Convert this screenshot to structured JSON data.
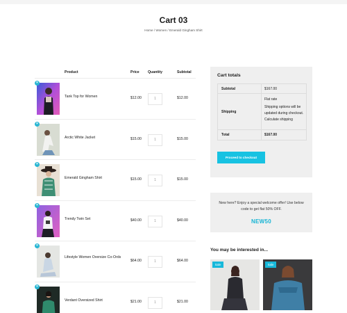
{
  "page": {
    "title": "Cart 03",
    "breadcrumb": "Home / Women / Emerald Gingham Shirt"
  },
  "cart": {
    "headers": {
      "product": "Product",
      "price": "Price",
      "quantity": "Quantity",
      "subtotal": "Subtotal"
    },
    "remove_symbol": "×",
    "items": [
      {
        "name": "Tank Top for Women",
        "price": "$12.00",
        "qty": "1",
        "subtotal": "$12.00"
      },
      {
        "name": "Arctic White Jacket",
        "price": "$15.00",
        "qty": "1",
        "subtotal": "$15.00"
      },
      {
        "name": "Emerald Gingham Shirt",
        "price": "$15.00",
        "qty": "1",
        "subtotal": "$15.00"
      },
      {
        "name": "Trendy Twin Set",
        "price": "$40.00",
        "qty": "1",
        "subtotal": "$40.00"
      },
      {
        "name": "Lifestyle Women Oversize Co-Ords",
        "price": "$64.00",
        "qty": "1",
        "subtotal": "$64.00"
      },
      {
        "name": "Verdant Oversized Shirt",
        "price": "$21.00",
        "qty": "1",
        "subtotal": "$21.00"
      }
    ]
  },
  "totals": {
    "title": "Cart totals",
    "subtotal_label": "Subtotal",
    "subtotal_value": "$167.00",
    "shipping_label": "Shipping",
    "shipping_method": "Flat rate",
    "shipping_note": "Shipping options will be updated during checkout. Calculate shipping",
    "total_label": "Total",
    "total_value": "$167.00",
    "checkout_label": "Proceed to checkout"
  },
  "promo": {
    "text": "New here? Enjoy a special welcome offer! Use below code to get flat 50% OFF.",
    "code": "NEW50"
  },
  "related": {
    "title": "You may be interested in...",
    "badges": [
      "Sale",
      "Sale"
    ]
  },
  "colors": {
    "accent": "#17c2e2",
    "panel": "#efefef"
  }
}
